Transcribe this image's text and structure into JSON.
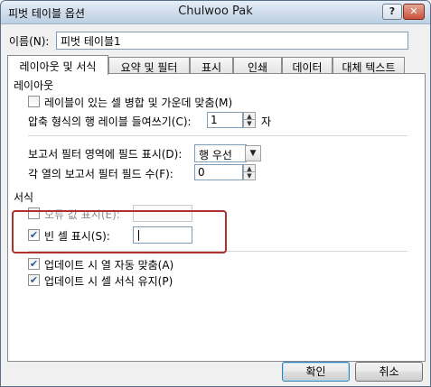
{
  "window": {
    "title_left": "피벗 테이블 옵션",
    "title_center": "Chulwoo Pak",
    "help_label": "?",
    "close_label": "✕"
  },
  "name_field": {
    "label": "이름(N):",
    "value": "피벗 테이블1"
  },
  "tabs": [
    {
      "label": "레이아웃 및 서식",
      "active": true
    },
    {
      "label": "요약 및 필터",
      "active": false
    },
    {
      "label": "표시",
      "active": false
    },
    {
      "label": "인쇄",
      "active": false
    },
    {
      "label": "데이터",
      "active": false
    },
    {
      "label": "대체 텍스트",
      "active": false
    }
  ],
  "layout_section": {
    "title": "레이아웃",
    "merge_center": {
      "label": "레이블이 있는 셀 병합 및 가운데 맞춤(M)",
      "checked": false
    },
    "indent": {
      "label": "압축 형식의 행 레이블 들여쓰기(C):",
      "value": "1",
      "unit": "자"
    },
    "report_filter_area": {
      "label": "보고서 필터 영역에 필드 표시(D):",
      "value": "행 우선"
    },
    "report_filter_per_col": {
      "label": "각 열의 보고서 필터 필드 수(F):",
      "value": "0"
    }
  },
  "format_section": {
    "title": "서식",
    "error_values": {
      "label": "오류 값 표시(E):",
      "checked": false,
      "value": ""
    },
    "empty_cells": {
      "label": "빈 셀 표시(S):",
      "checked": true,
      "value": ""
    },
    "autofit_columns": {
      "label": "업데이트 시 열 자동 맞춤(A)",
      "checked": true
    },
    "preserve_formatting": {
      "label": "업데이트 시 셀 서식 유지(P)",
      "checked": true
    }
  },
  "buttons": {
    "ok": "확인",
    "cancel": "취소"
  },
  "colors": {
    "highlight": "#b03030",
    "accent": "#3c7fb1"
  }
}
